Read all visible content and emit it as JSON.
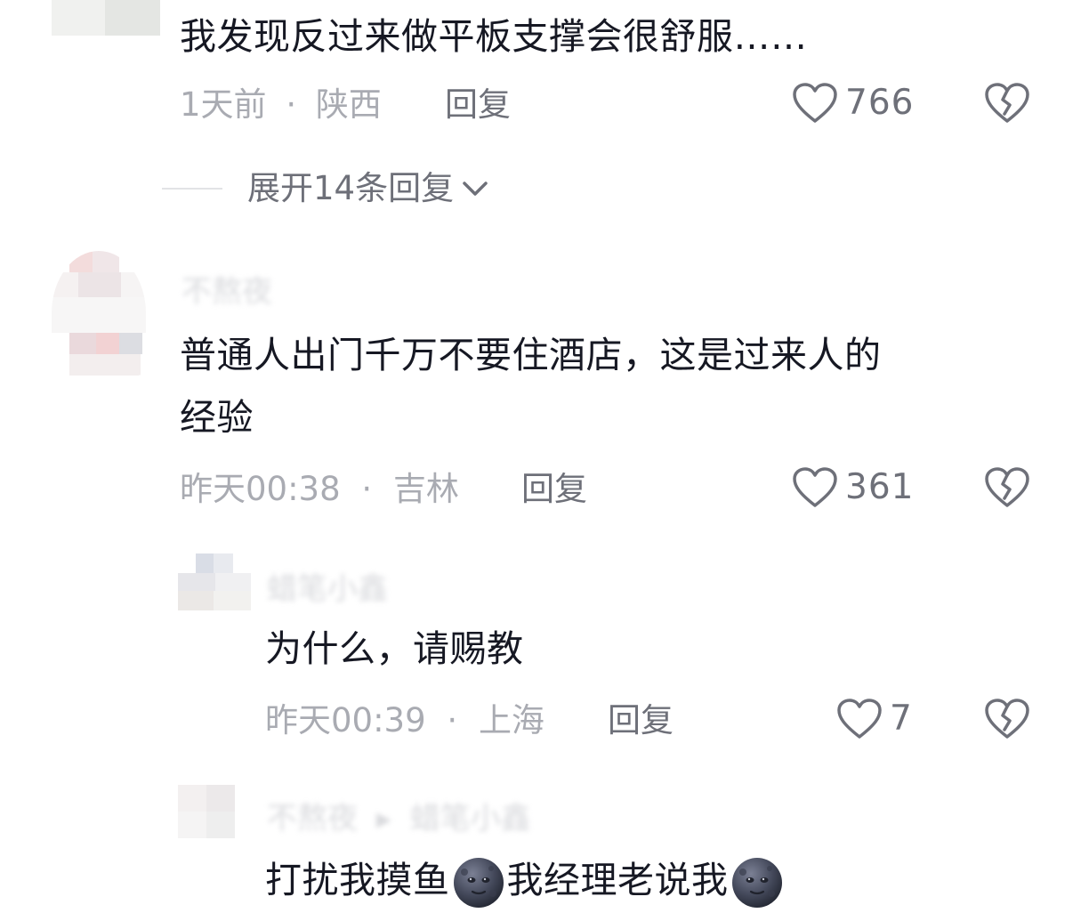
{
  "comments": [
    {
      "text": "我发现反过来做平板支撑会很舒服……",
      "time": "1天前",
      "sep": "·",
      "location": "陕西",
      "reply_label": "回复",
      "likes": "766",
      "expand_label": "展开14条回复"
    },
    {
      "username": "不熬夜",
      "text_line1": "普通人出门千万不要住酒店，这是过来人的",
      "text_line2": "经验",
      "time": "昨天00:38",
      "sep": "·",
      "location": "吉林",
      "reply_label": "回复",
      "likes": "361"
    }
  ],
  "replies": [
    {
      "username": "蜡笔小鑫",
      "text": "为什么，请赐教",
      "time": "昨天00:39",
      "sep": "·",
      "location": "上海",
      "reply_label": "回复",
      "likes": "7"
    },
    {
      "username": "不熬夜",
      "reply_arrow": "▸",
      "reply_to": "蜡笔小鑫",
      "text_part1": "打扰我摸鱼",
      "text_part2": "我经理老说我",
      "emoji_icon": "new-moon-face-icon"
    }
  ],
  "colors": {
    "text": "#161823",
    "meta": "#a9abb2",
    "action": "#6e7079"
  }
}
